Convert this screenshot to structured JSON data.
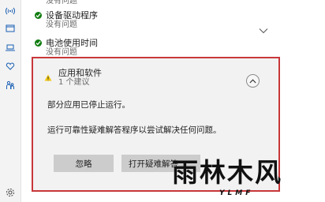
{
  "items": [
    {
      "partial_subtitle": "没有问题"
    },
    {
      "title": "设备驱动程序",
      "subtitle": "没有问题"
    },
    {
      "title": "电池使用时间",
      "subtitle": "没有问题"
    }
  ],
  "expanded": {
    "title": "应用和软件",
    "subtitle": "1 个建议",
    "message1": "部分应用已停止运行。",
    "message2": "运行可靠性疑难解答程序以尝试解决任何问题。",
    "ignore_label": "忽略",
    "run_label": "打开疑难解答"
  },
  "colors": {
    "ok": "#107c10",
    "warning": "#f2c811",
    "highlight_border": "#c8373a"
  },
  "icons": [
    "wifi-icon",
    "window-icon",
    "laptop-icon",
    "heart-icon",
    "family-icon",
    "gear-icon"
  ],
  "watermark": {
    "main": "雨林木风",
    "sub": "YLMF"
  }
}
